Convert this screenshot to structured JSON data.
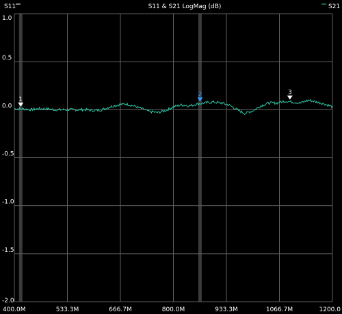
{
  "chart_data": {
    "type": "line",
    "title": "S11 & S21 LogMag (dB)",
    "legend": [
      {
        "name": "S11",
        "color": "#ffffff",
        "position": "top-left"
      },
      {
        "name": "S21",
        "color": "#2ec4a4",
        "position": "top-right"
      }
    ],
    "x_unit": "Hz",
    "xlim": [
      400000000,
      1200000000
    ],
    "ylim": [
      -2.0,
      1.0
    ],
    "x_tick_labels": [
      "400.0M",
      "533.3M",
      "666.7M",
      "800.0M",
      "933.3M",
      "1066.7M",
      "1200.0"
    ],
    "y_tick_values": [
      1.0,
      0.5,
      0.0,
      -0.5,
      -1.0,
      -1.5,
      -2.0
    ],
    "y_tick_labels": [
      "1.0",
      "0.5",
      "0.0",
      "-0.5",
      "-1.0",
      "-1.5",
      "-2.0"
    ],
    "grid": true,
    "series": [
      {
        "name": "S21",
        "color": "#2ec4a4",
        "x": [
          400000000,
          420000000,
          440000000,
          460000000,
          480000000,
          500000000,
          520000000,
          540000000,
          560000000,
          580000000,
          600000000,
          620000000,
          640000000,
          660000000,
          680000000,
          700000000,
          720000000,
          740000000,
          760000000,
          780000000,
          800000000,
          820000000,
          840000000,
          860000000,
          880000000,
          900000000,
          920000000,
          940000000,
          960000000,
          980000000,
          1000000000,
          1020000000,
          1040000000,
          1060000000,
          1080000000,
          1100000000,
          1120000000,
          1140000000,
          1160000000,
          1180000000,
          1200000000
        ],
        "y": [
          0.01,
          0.01,
          0.0,
          0.01,
          0.01,
          0.0,
          0.0,
          0.0,
          0.0,
          0.0,
          -0.01,
          0.0,
          0.03,
          0.05,
          0.06,
          0.04,
          0.01,
          -0.02,
          -0.03,
          -0.01,
          0.03,
          0.05,
          0.04,
          0.06,
          0.07,
          0.08,
          0.07,
          0.05,
          0.0,
          -0.04,
          -0.01,
          0.04,
          0.07,
          0.07,
          0.09,
          0.08,
          0.07,
          0.1,
          0.08,
          0.06,
          0.03
        ]
      }
    ],
    "markers": [
      {
        "label": "1",
        "x": 416000000,
        "color": "#ffffff"
      },
      {
        "label": "2",
        "x": 867000000,
        "color": "#3399ff"
      },
      {
        "label": "3",
        "x": 1093000000,
        "color": "#ffffff"
      }
    ],
    "highlight_bands": [
      416000000,
      867000000
    ]
  }
}
